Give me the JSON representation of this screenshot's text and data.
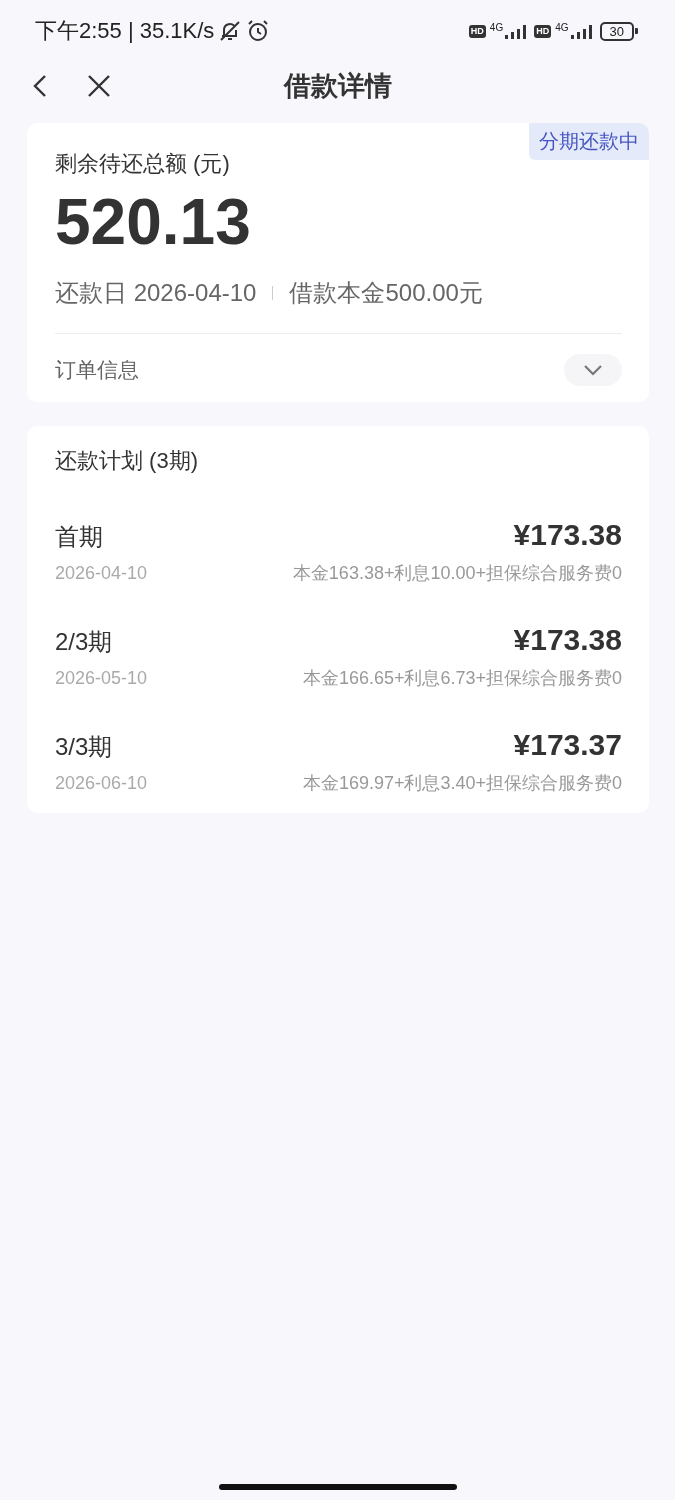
{
  "status_bar": {
    "time": "下午2:55 | 35.1K/s",
    "hd_badges": [
      "HD",
      "HD"
    ],
    "network_labels": [
      "4G",
      "4G"
    ],
    "battery": "30"
  },
  "nav": {
    "title": "借款详情"
  },
  "summary": {
    "status_badge": "分期还款中",
    "label": "剩余待还总额 (元)",
    "amount": "520.13",
    "due_date": "还款日 2026-04-10",
    "principal": "借款本金500.00元",
    "order_info": {
      "label": "订单信息",
      "expanded": false
    }
  },
  "plan": {
    "title": "还款计划 (3期)",
    "installments": [
      {
        "name": "首期",
        "amount": "¥173.38",
        "date": "2026-04-10",
        "breakdown": "本金163.38+利息10.00+担保综合服务费0"
      },
      {
        "name": "2/3期",
        "amount": "¥173.38",
        "date": "2026-05-10",
        "breakdown": "本金166.65+利息6.73+担保综合服务费0"
      },
      {
        "name": "3/3期",
        "amount": "¥173.37",
        "date": "2026-06-10",
        "breakdown": "本金169.97+利息3.40+担保综合服务费0"
      }
    ]
  }
}
